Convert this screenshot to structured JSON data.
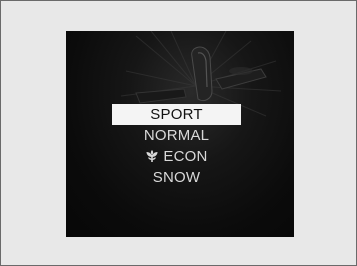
{
  "drive_mode_menu": {
    "items": [
      {
        "label": "SPORT",
        "selected": true
      },
      {
        "label": "NORMAL",
        "selected": false
      },
      {
        "label": "ECON",
        "selected": false,
        "icon": "eco-leaf-icon"
      },
      {
        "label": "SNOW",
        "selected": false
      }
    ]
  },
  "colors": {
    "frame_background": "#e8e8e8",
    "screen_background": "#0b0b0b",
    "selected_highlight": "#f4f4f4",
    "menu_text": "#d9d9d9"
  }
}
